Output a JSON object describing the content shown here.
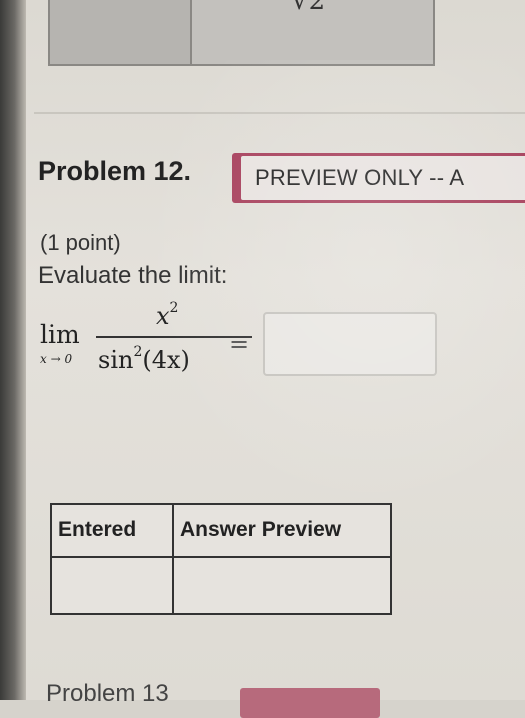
{
  "top_table": {
    "glyph": "√2"
  },
  "problem": {
    "title": "Problem 12.",
    "badge": "PREVIEW ONLY -- A",
    "points": "(1 point)",
    "instruction": "Evaluate the limit:"
  },
  "math": {
    "lim": "lim",
    "lim_sub": "x → 0",
    "numerator_base": "x",
    "numerator_exp": "2",
    "denominator_fn": "sin",
    "denominator_exp": "2",
    "denominator_arg": "(4x)",
    "equals": "="
  },
  "answer": {
    "value": ""
  },
  "answer_table": {
    "headers": [
      "Entered",
      "Answer Preview"
    ]
  },
  "next_problem": {
    "title": "Problem 13"
  }
}
